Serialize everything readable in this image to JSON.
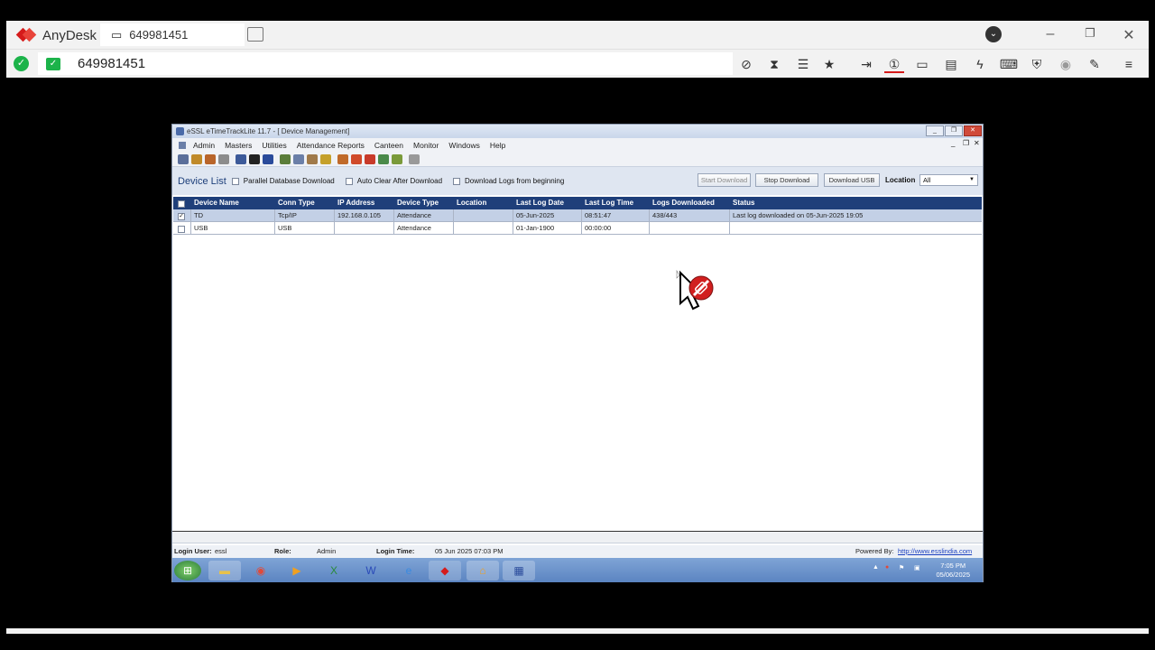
{
  "anydesk": {
    "app_name": "AnyDesk",
    "tab_label": "649981451",
    "address": "649981451",
    "toolbar_icons": [
      "screen-off-icon",
      "hourglass-icon",
      "database-icon",
      "star-icon",
      "file-transfer-icon",
      "monitor-1-icon",
      "display-icon",
      "chat-icon",
      "action-icon",
      "keyboard-icon",
      "privacy-icon",
      "record-icon",
      "draw-icon",
      "menu-icon"
    ]
  },
  "window": {
    "title": "eSSL eTimeTrackLite 11.7 - [ Device Management]"
  },
  "menu": [
    "Admin",
    "Masters",
    "Utilities",
    "Attendance Reports",
    "Canteen",
    "Monitor",
    "Windows",
    "Help"
  ],
  "device_header": {
    "title": "Device List",
    "option_parallel": "Parallel Database Download",
    "option_autoclear": "Auto Clear After Download",
    "option_from_beginning": "Download Logs from beginning",
    "start_download": "Start Download",
    "stop_download": "Stop Download",
    "download_usb": "Download USB",
    "location_label": "Location",
    "location_value": "All"
  },
  "grid": {
    "columns": [
      "Device Name",
      "Conn Type",
      "IP Address",
      "Device Type",
      "Location",
      "Last Log Date",
      "Last Log Time",
      "Logs Downloaded",
      "Status"
    ],
    "rows": [
      {
        "checked": "✓",
        "name": "TD",
        "conn": "Tcp/IP",
        "ip": "192.168.0.105",
        "type": "Attendance",
        "location": "",
        "date": "05-Jun-2025",
        "time": "08:51:47",
        "logs": "438/443",
        "status": "Last log downloaded on 05-Jun-2025 19:05"
      },
      {
        "checked": "",
        "name": "USB",
        "conn": "USB",
        "ip": "",
        "type": "Attendance",
        "location": "",
        "date": "01-Jan-1900",
        "time": "00:00:00",
        "logs": "",
        "status": ""
      }
    ]
  },
  "status": {
    "login_user_label": "Login User:",
    "login_user": "essl",
    "role_label": "Role:",
    "role": "Admin",
    "login_time_label": "Login Time:",
    "login_time": "05 Jun 2025 07:03 PM",
    "powered_label": "Powered By:",
    "powered_link": "http://www.essl​india.com"
  },
  "taskbar": {
    "time": "7:05 PM",
    "date": "05/06/2025"
  }
}
